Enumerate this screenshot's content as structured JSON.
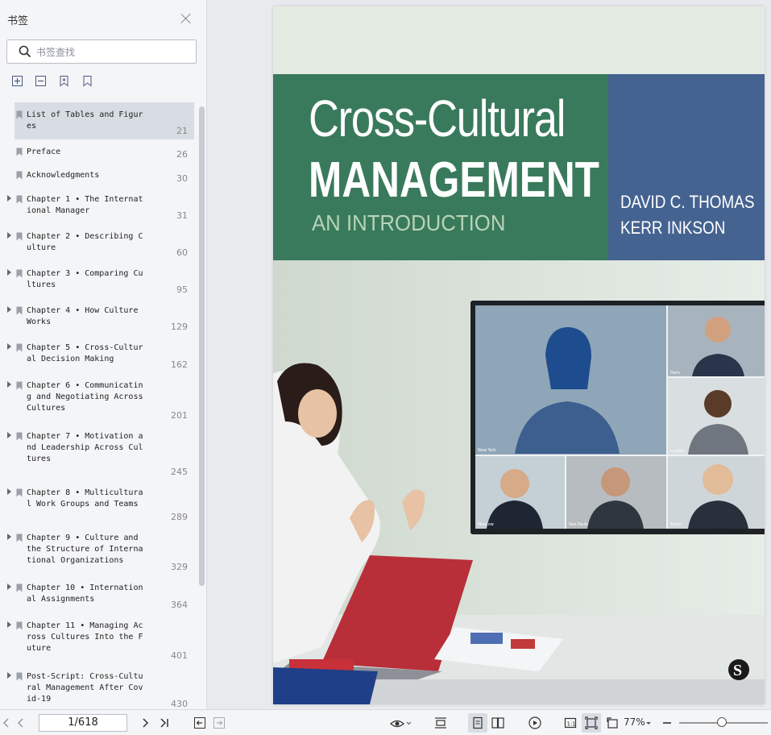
{
  "sidebar": {
    "title": "书签",
    "search_placeholder": "书签查找",
    "items": [
      {
        "label": "List of Tables and Figur\nes",
        "page": "21",
        "expandable": false,
        "selected": true
      },
      {
        "label": "Preface",
        "page": "26",
        "expandable": false
      },
      {
        "label": "Acknowledgments",
        "page": "30",
        "expandable": false
      },
      {
        "label": "Chapter 1 • The Internat\nional Manager",
        "page": "31",
        "expandable": true
      },
      {
        "label": "Chapter 2 • Describing C\nulture",
        "page": "60",
        "expandable": true
      },
      {
        "label": "Chapter 3 • Comparing Cu\nltures",
        "page": "95",
        "expandable": true
      },
      {
        "label": "Chapter 4 • How Culture\nWorks",
        "page": "129",
        "expandable": true
      },
      {
        "label": "Chapter 5 • Cross-Cultur\nal Decision Making",
        "page": "162",
        "expandable": true
      },
      {
        "label": "Chapter 6 • Communicatin\ng and Negotiating Across\nCultures",
        "page": "201",
        "expandable": true
      },
      {
        "label": "Chapter 7 • Motivation a\nnd Leadership Across Cul\ntures",
        "page": "245",
        "expandable": true
      },
      {
        "label": "Chapter 8 • Multicultura\nl Work Groups and Teams",
        "page": "289",
        "expandable": true
      },
      {
        "label": "Chapter 9 • Culture and\nthe Structure of Interna\ntional Organizations",
        "page": "329",
        "expandable": true
      },
      {
        "label": "Chapter 10 • Internation\nal Assignments",
        "page": "364",
        "expandable": true
      },
      {
        "label": "Chapter 11 • Managing Ac\nross Cultures Into the F\nuture",
        "page": "401",
        "expandable": true
      },
      {
        "label": "Post-Script: Cross-Cultu\nral Management After Cov\nid-19",
        "page": "430",
        "expandable": true
      }
    ]
  },
  "cover": {
    "title_line1": "Cross-Cultural",
    "title_line2": "MANAGEMENT",
    "subtitle": "AN INTRODUCTION",
    "authors": [
      "DAVID C. THOMAS",
      "KERR INKSON"
    ],
    "video_tiles": [
      "New York",
      "Paris",
      "London",
      "Moscow",
      "Sao Paulo",
      "Tokyo"
    ],
    "colors": {
      "green": "#3a7a5c",
      "blue": "#456391",
      "subtitle": "#b7d4b7"
    }
  },
  "bottombar": {
    "page_indicator": "1/618",
    "zoom": "77%"
  }
}
